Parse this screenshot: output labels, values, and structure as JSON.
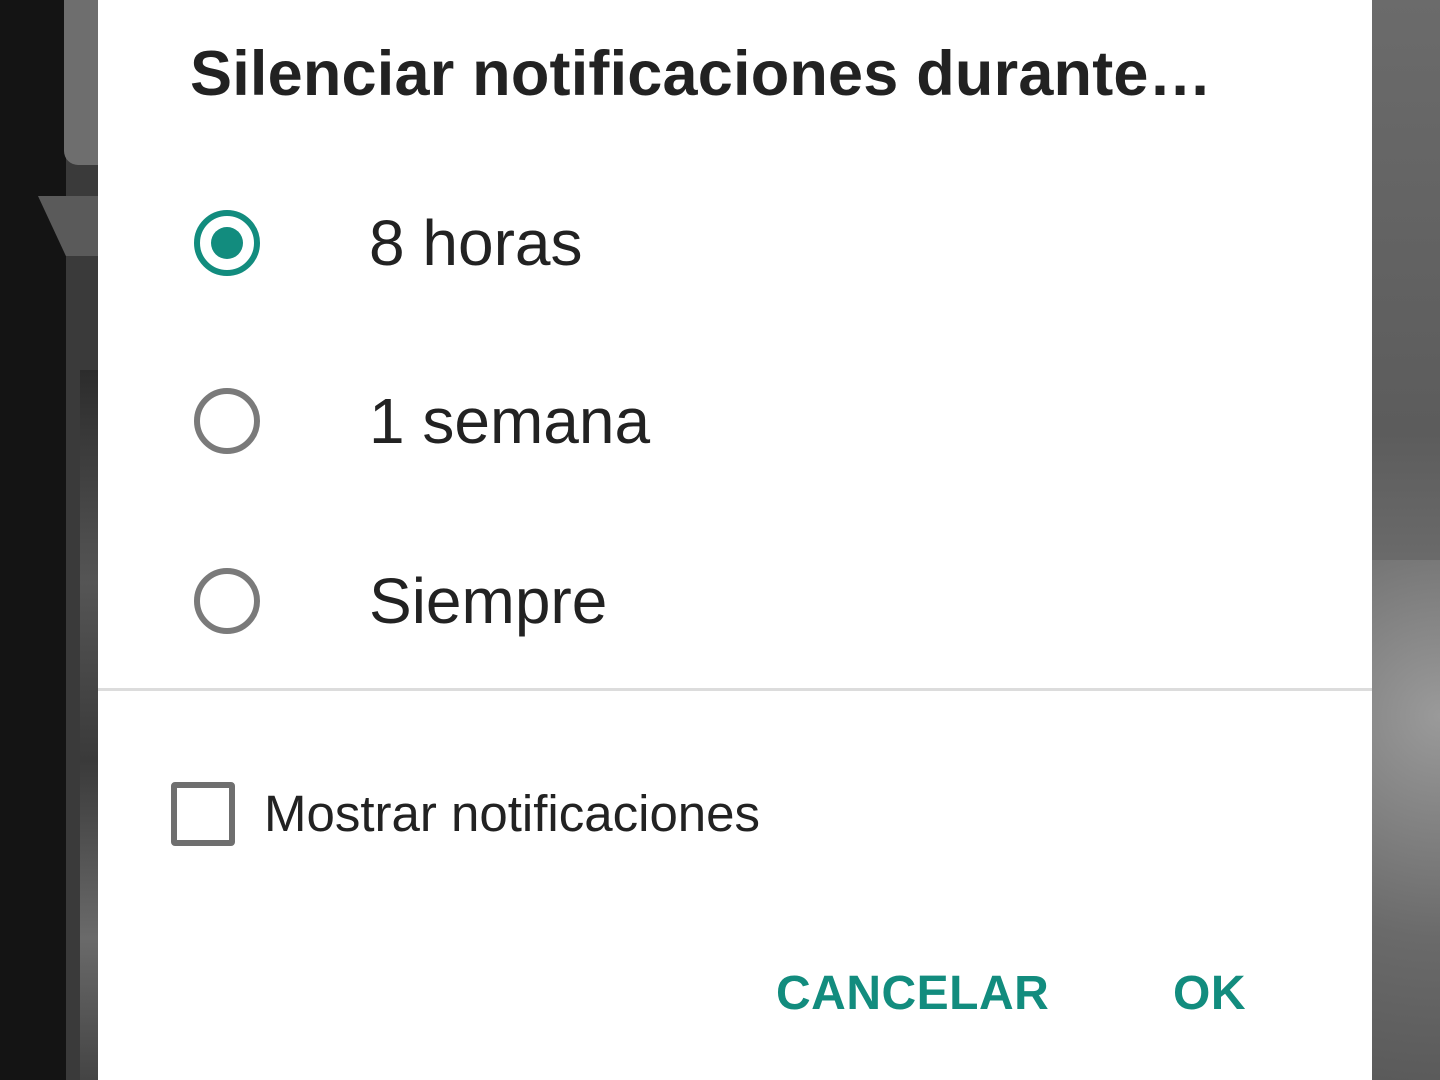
{
  "dialog": {
    "title": "Silenciar notificaciones durante…",
    "options": [
      {
        "label": "8 horas",
        "selected": true
      },
      {
        "label": "1 semana",
        "selected": false
      },
      {
        "label": "Siempre",
        "selected": false
      }
    ],
    "show_notifications": {
      "label": "Mostrar notificaciones",
      "checked": false
    },
    "buttons": {
      "cancel": "CANCELAR",
      "ok": "OK"
    }
  },
  "colors": {
    "accent": "#128C7E",
    "text": "#222222",
    "radio_unchecked": "#7a7a7a",
    "background": "#ffffff",
    "scrim": "#1a1a1a"
  },
  "icons": {
    "radio_selected": "radio-button-checked-icon",
    "radio_unselected": "radio-button-unchecked-icon",
    "checkbox_unchecked": "checkbox-unchecked-icon"
  }
}
